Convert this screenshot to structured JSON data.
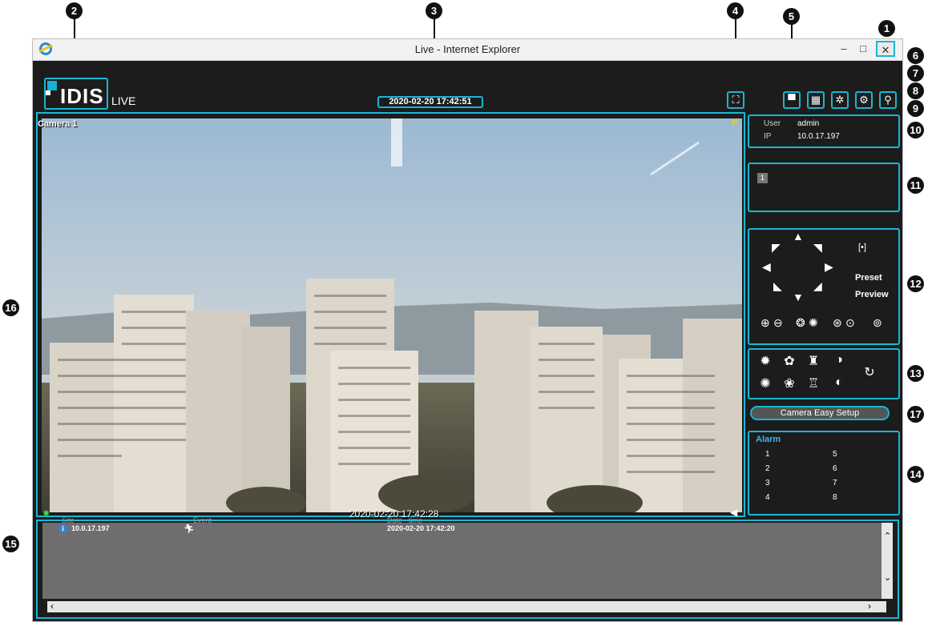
{
  "window": {
    "title": "Live - Internet Explorer",
    "minimize": "–",
    "maximize": "□",
    "close": "✕"
  },
  "header": {
    "logo": "IDIS",
    "mode": "LIVE",
    "datetime": "2020-02-20 17:42:51"
  },
  "video": {
    "camera_label": "Camera 1",
    "ptz_badge": "P",
    "timestamp": "2020-02-20 17:42:28"
  },
  "user_panel": {
    "user_label": "User",
    "user_value": "admin",
    "ip_label": "IP",
    "ip_value": "10.0.17.197"
  },
  "camera_panel": {
    "camera_number": "1"
  },
  "ptz": {
    "preset_label": "Preset",
    "preview_label": "Preview"
  },
  "easy_setup": {
    "label": "Camera Easy Setup"
  },
  "alarm": {
    "title": "Alarm",
    "left": [
      "1",
      "2",
      "3",
      "4"
    ],
    "right": [
      "5",
      "6",
      "7",
      "8"
    ]
  },
  "log": {
    "headers": [
      "Site",
      "Event",
      "Date - time"
    ],
    "rows": [
      {
        "site": "10.0.17.197",
        "datetime": "2020-02-20 17:42:20"
      }
    ]
  },
  "callouts": [
    "1",
    "2",
    "3",
    "4",
    "5",
    "6",
    "7",
    "8",
    "9",
    "10",
    "11",
    "12",
    "13",
    "14",
    "15",
    "16",
    "17"
  ]
}
